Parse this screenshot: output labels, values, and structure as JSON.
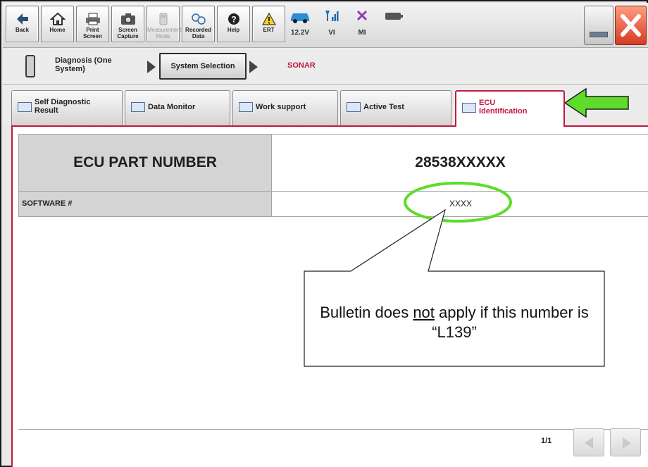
{
  "toolbar": {
    "buttons": [
      {
        "label": "Back",
        "icon": "back-arrow-icon"
      },
      {
        "label": "Home",
        "icon": "home-icon"
      },
      {
        "label": "Print Screen",
        "icon": "printer-icon"
      },
      {
        "label": "Screen Capture",
        "icon": "camera-icon"
      },
      {
        "label": "Measurement Mode",
        "icon": "measurement-icon",
        "disabled": true
      },
      {
        "label": "Recorded Data",
        "icon": "recorded-data-icon"
      },
      {
        "label": "Help",
        "icon": "help-icon"
      },
      {
        "label": "ERT",
        "icon": "warning-icon"
      }
    ],
    "status": {
      "battery": "12.2V",
      "vi": "VI",
      "mi": "MI"
    }
  },
  "breadcrumb": {
    "diagnosis": "Diagnosis (One System)",
    "system_selection": "System Selection",
    "current": "SONAR"
  },
  "tabs": [
    {
      "label": "Self Diagnostic Result",
      "active": false
    },
    {
      "label": "Data Monitor",
      "active": false
    },
    {
      "label": "Work support",
      "active": false
    },
    {
      "label": "Active Test",
      "active": false
    },
    {
      "label": "ECU Identification",
      "active": true
    }
  ],
  "ecu": {
    "part_label": "ECU PART NUMBER",
    "part_value": "28538XXXXX",
    "software_label": "SOFTWARE #",
    "software_value": "XXXX"
  },
  "pagination": {
    "indicator": "1/1"
  },
  "callout": {
    "text_before": "Bulletin does ",
    "text_underlined": "not",
    "text_after": " apply if this number is “L139”"
  },
  "colors": {
    "accent": "#c2183f",
    "highlight": "#5ddc2a"
  }
}
